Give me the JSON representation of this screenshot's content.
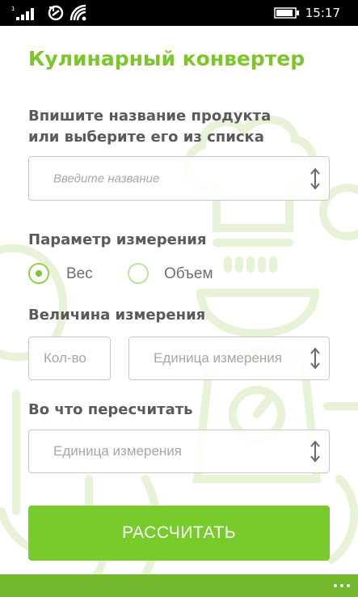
{
  "status_bar": {
    "time": "15:17",
    "icons": [
      "signal-icon",
      "sync-icon",
      "wifi-icon",
      "battery-icon"
    ]
  },
  "app": {
    "title": "Кулинарный конвертер",
    "product": {
      "label_line1": "Впишите название продукта",
      "label_line2": "или выберите его из списка",
      "placeholder": "Введите название"
    },
    "parameter": {
      "label": "Параметр измерения",
      "options": [
        {
          "label": "Вес",
          "selected": true
        },
        {
          "label": "Объем",
          "selected": false
        }
      ]
    },
    "magnitude": {
      "label": "Величина измерения",
      "quantity_placeholder": "Кол-во",
      "unit_placeholder": "Единица измерения"
    },
    "convert_to": {
      "label": "Во что пересчитать",
      "unit_placeholder": "Единица измерения"
    },
    "calculate_button": "РАССЧИТАТЬ"
  },
  "colors": {
    "accent": "#7cc52b",
    "button": "#77cb2a",
    "app_bar": "#74b82e",
    "label_text": "#5a5a5a",
    "placeholder_text": "#a7a7a7"
  }
}
